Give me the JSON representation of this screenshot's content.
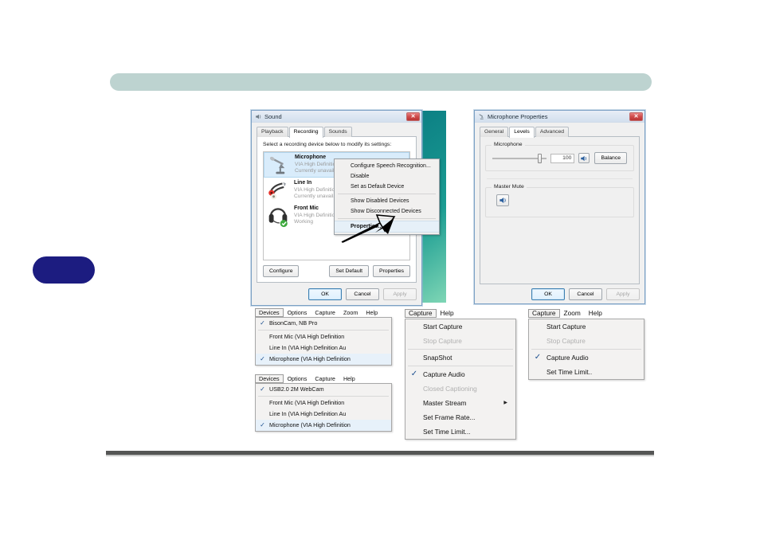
{
  "sound_dialog": {
    "title": "Sound",
    "title_icon": "speaker-icon",
    "close_label": "✕",
    "tabs": [
      {
        "label": "Playback",
        "active": false
      },
      {
        "label": "Recording",
        "active": true
      },
      {
        "label": "Sounds",
        "active": false
      }
    ],
    "hint": "Select a recording device below to modify its settings:",
    "devices": [
      {
        "icon": "microphone-icon",
        "name": "Microphone",
        "line2": "VIA High Definition",
        "line3": "Currently unavailab",
        "selected": true
      },
      {
        "icon": "line-in-jack-icon",
        "name": "Line In",
        "line2": "VIA High Definition",
        "line3": "Currently unavailab",
        "selected": false
      },
      {
        "icon": "headset-icon",
        "name": "Front Mic",
        "line2": "VIA High Definition",
        "line3": "Working",
        "selected": false
      }
    ],
    "buttons": {
      "configure": "Configure",
      "set_default": "Set Default",
      "properties": "Properties",
      "ok": "OK",
      "cancel": "Cancel",
      "apply": "Apply"
    },
    "context_menu": [
      {
        "label": "Configure Speech Recognition...",
        "bold": false,
        "highlight": false,
        "separator_before": false
      },
      {
        "label": "Disable",
        "bold": false,
        "highlight": false,
        "separator_before": false
      },
      {
        "label": "Set as Default Device",
        "bold": false,
        "highlight": false,
        "separator_before": false
      },
      {
        "label": "Show Disabled Devices",
        "bold": false,
        "highlight": false,
        "separator_before": true
      },
      {
        "label": "Show Disconnected Devices",
        "bold": false,
        "highlight": false,
        "separator_before": false
      },
      {
        "label": "Properties...",
        "bold": true,
        "highlight": true,
        "separator_before": true
      }
    ]
  },
  "mic_properties": {
    "title": "Microphone Properties",
    "title_icon": "microphone-icon",
    "close_label": "✕",
    "tabs": [
      {
        "label": "General",
        "active": false
      },
      {
        "label": "Levels",
        "active": true
      },
      {
        "label": "Advanced",
        "active": false
      }
    ],
    "microphone_group": {
      "label": "Microphone",
      "value": "100",
      "speaker_icon": "speaker-on-icon",
      "balance_label": "Balance"
    },
    "master_mute_group": {
      "label": "Master Mute",
      "mute_icon": "speaker-on-icon"
    },
    "buttons": {
      "ok": "OK",
      "cancel": "Cancel",
      "apply": "Apply"
    }
  },
  "devices_menu_top": {
    "menubar": [
      {
        "label": "Devices",
        "open": true
      },
      {
        "label": "Options",
        "open": false
      },
      {
        "label": "Capture",
        "open": false
      },
      {
        "label": "Zoom",
        "open": false
      },
      {
        "label": "Help",
        "open": false
      }
    ],
    "items": [
      {
        "label": "BisonCam, NB Pro",
        "checked": true,
        "disabled": false,
        "selected": false,
        "separator_before": false
      },
      {
        "label": "Front Mic (VIA High Definition",
        "checked": false,
        "disabled": false,
        "selected": false,
        "separator_before": true
      },
      {
        "label": "Line In (VIA High Definition Au",
        "checked": false,
        "disabled": false,
        "selected": false,
        "separator_before": false
      },
      {
        "label": "Microphone (VIA High Definition",
        "checked": true,
        "disabled": false,
        "selected": true,
        "separator_before": false
      }
    ]
  },
  "devices_menu_bottom": {
    "menubar": [
      {
        "label": "Devices",
        "open": true
      },
      {
        "label": "Options",
        "open": false
      },
      {
        "label": "Capture",
        "open": false
      },
      {
        "label": "Help",
        "open": false
      }
    ],
    "items": [
      {
        "label": "USB2.0 2M WebCam",
        "checked": true,
        "disabled": false,
        "selected": false,
        "separator_before": false
      },
      {
        "label": "Front Mic (VIA High Definition",
        "checked": false,
        "disabled": false,
        "selected": false,
        "separator_before": true
      },
      {
        "label": "Line In (VIA High Definition Au",
        "checked": false,
        "disabled": false,
        "selected": false,
        "separator_before": false
      },
      {
        "label": "Microphone (VIA High Definition",
        "checked": true,
        "disabled": false,
        "selected": true,
        "separator_before": false
      }
    ]
  },
  "capture_menu_full": {
    "menubar": [
      {
        "label": "Capture",
        "open": true
      },
      {
        "label": "Help",
        "open": false
      }
    ],
    "items": [
      {
        "label": "Start Capture",
        "checked": false,
        "disabled": false,
        "submenu": false,
        "separator_before": false
      },
      {
        "label": "Stop Capture",
        "checked": false,
        "disabled": true,
        "submenu": false,
        "separator_before": false
      },
      {
        "label": "SnapShot",
        "checked": false,
        "disabled": false,
        "submenu": false,
        "separator_before": true
      },
      {
        "label": "Capture Audio",
        "checked": true,
        "disabled": false,
        "submenu": false,
        "separator_before": true
      },
      {
        "label": "Closed Captioning",
        "checked": false,
        "disabled": true,
        "submenu": false,
        "separator_before": false
      },
      {
        "label": "Master Stream",
        "checked": false,
        "disabled": false,
        "submenu": true,
        "separator_before": false
      },
      {
        "label": "Set Frame Rate...",
        "checked": false,
        "disabled": false,
        "submenu": false,
        "separator_before": false
      },
      {
        "label": "Set Time Limit...",
        "checked": false,
        "disabled": false,
        "submenu": false,
        "separator_before": false
      }
    ]
  },
  "capture_menu_short": {
    "menubar": [
      {
        "label": "Capture",
        "open": true
      },
      {
        "label": "Zoom",
        "open": false
      },
      {
        "label": "Help",
        "open": false
      }
    ],
    "items": [
      {
        "label": "Start Capture",
        "checked": false,
        "disabled": false,
        "submenu": false,
        "separator_before": false
      },
      {
        "label": "Stop Capture",
        "checked": false,
        "disabled": true,
        "submenu": false,
        "separator_before": false
      },
      {
        "label": "Capture Audio",
        "checked": true,
        "disabled": false,
        "submenu": false,
        "separator_before": true
      },
      {
        "label": "Set Time Limit..",
        "checked": false,
        "disabled": false,
        "submenu": false,
        "separator_before": false
      }
    ]
  },
  "colors": {
    "header_bar": "#bdd3d0",
    "side_tab": "#1c1c80",
    "footer_rule": "#555655",
    "selection": "#d9ecfb",
    "close_red": "#cf4b4b"
  }
}
